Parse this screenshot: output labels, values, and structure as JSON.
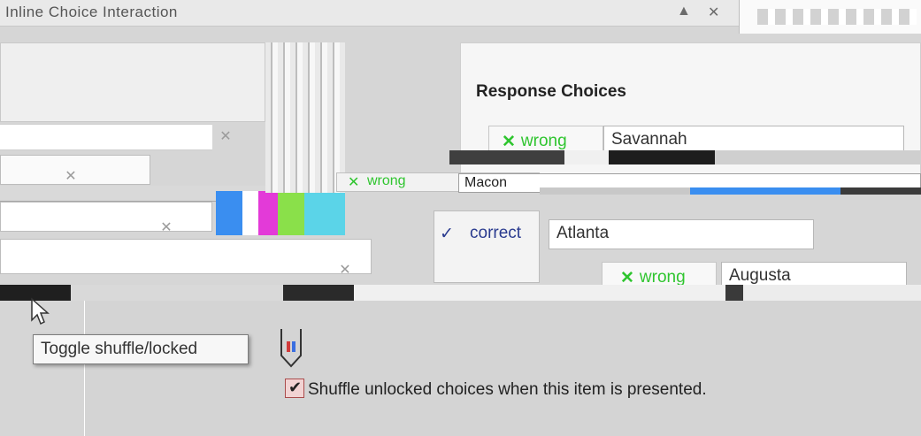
{
  "window": {
    "title": "Inline Choice Interaction"
  },
  "panel": {
    "heading": "Response Choices"
  },
  "choices": [
    {
      "status": "wrong",
      "mark": "✕",
      "value": "Savannah"
    },
    {
      "status": "wrong",
      "mark": "✕",
      "value": "Macon"
    },
    {
      "status": "correct",
      "mark": "✓",
      "value": "Atlanta"
    },
    {
      "status": "wrong",
      "mark": "✕",
      "value": "Augusta"
    }
  ],
  "tooltip": {
    "text": "Toggle shuffle/locked"
  },
  "options": {
    "shuffle_label": "Shuffle unlocked choices when this item is presented.",
    "shuffle_checked": true
  },
  "colors": {
    "wrong": "#2fc52f",
    "correct": "#2a3b8f",
    "tooltip_border": "#7c7c7c"
  },
  "icons": [
    "close-icon",
    "remove-icon",
    "lock-icon",
    "cursor-icon",
    "check-icon"
  ]
}
